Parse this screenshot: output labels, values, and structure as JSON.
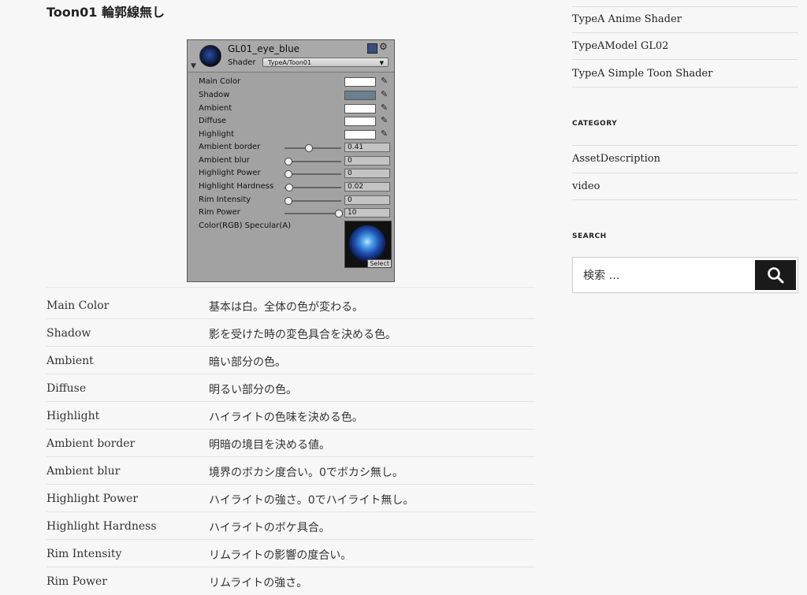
{
  "page_title": "Toon01 輪郭線無し",
  "inspector": {
    "material_name": "GL01_eye_blue",
    "shader_label": "Shader",
    "shader_value": "TypeA/Toon01",
    "colors": [
      {
        "label": "Main Color",
        "color": "#ffffff"
      },
      {
        "label": "Shadow",
        "color": "#6a8090"
      },
      {
        "label": "Ambient",
        "color": "#ffffff"
      },
      {
        "label": "Diffuse",
        "color": "#ffffff"
      },
      {
        "label": "Highlight",
        "color": "#ffffff"
      }
    ],
    "sliders": [
      {
        "label": "Ambient border",
        "value": "0.41",
        "level": 0.41
      },
      {
        "label": "Ambient blur",
        "value": "0",
        "level": 0
      },
      {
        "label": "Highlight Power",
        "value": "0",
        "level": 0
      },
      {
        "label": "Highlight Hardness",
        "value": "0.02",
        "level": 0.02
      },
      {
        "label": "Rim Intensity",
        "value": "0",
        "level": 0
      },
      {
        "label": "Rim Power",
        "value": "10",
        "level": 1
      }
    ],
    "texture_label": "Color(RGB) Specular(A)",
    "texture_select": "Select"
  },
  "table": [
    {
      "name": "Main Color",
      "desc": "基本は白。全体の色が変わる。"
    },
    {
      "name": "Shadow",
      "desc": "影を受けた時の変色具合を決める色。"
    },
    {
      "name": "Ambient",
      "desc": "暗い部分の色。"
    },
    {
      "name": "Diffuse",
      "desc": "明るい部分の色。"
    },
    {
      "name": "Highlight",
      "desc": "ハイライトの色味を決める色。"
    },
    {
      "name": "Ambient border",
      "desc": "明暗の境目を決める値。"
    },
    {
      "name": "Ambient blur",
      "desc": "境界のボカシ度合い。0でボカシ無し。"
    },
    {
      "name": "Highlight Power",
      "desc": "ハイライトの強さ。0でハイライト無し。"
    },
    {
      "name": "Highlight Hardness",
      "desc": "ハイライトのボケ具合。"
    },
    {
      "name": "Rim Intensity",
      "desc": "リムライトの影響の度合い。"
    },
    {
      "name": "Rim Power",
      "desc": "リムライトの強さ。"
    }
  ],
  "sidebar": {
    "links": [
      "TypeA Anime Shader",
      "TypeAModel GL02",
      "TypeA Simple Toon Shader"
    ],
    "category_heading": "CATEGORY",
    "categories": [
      "AssetDescription",
      "video"
    ],
    "search_heading": "SEARCH",
    "search_placeholder": "検索 …"
  }
}
